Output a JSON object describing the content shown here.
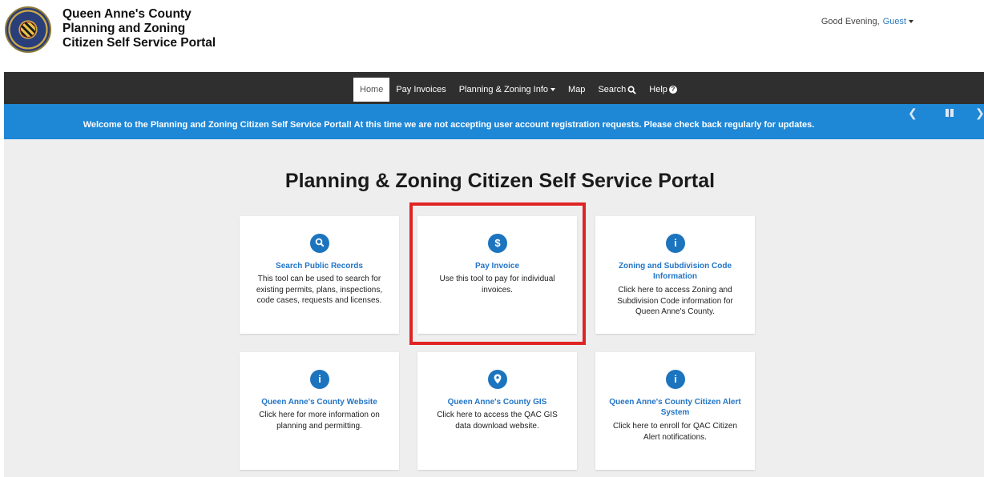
{
  "header": {
    "brand_line1": "Queen Anne's County",
    "brand_line2": "Planning and Zoning",
    "brand_line3": "Citizen Self Service Portal",
    "greeting": "Good Evening,",
    "user": "Guest"
  },
  "nav": {
    "items": [
      {
        "label": "Home",
        "active": true
      },
      {
        "label": "Pay Invoices"
      },
      {
        "label": "Planning & Zoning Info"
      },
      {
        "label": "Map"
      },
      {
        "label": "Search"
      },
      {
        "label": "Help"
      }
    ]
  },
  "banner": {
    "text": "Welcome to the Planning and Zoning Citizen Self Service Portal! At this time we are not accepting user account registration requests. Please check back regularly for updates."
  },
  "page": {
    "title": "Planning & Zoning Citizen Self Service Portal"
  },
  "cards": [
    {
      "icon": "search-icon",
      "title": "Search Public Records",
      "desc": "This tool can be used to search for existing permits, plans, inspections, code cases, requests and licenses."
    },
    {
      "icon": "dollar-icon",
      "title": "Pay Invoice",
      "desc": "Use this tool to pay for individual invoices."
    },
    {
      "icon": "info-icon",
      "title": "Zoning and Subdivision Code Information",
      "desc": "Click here to access Zoning and Subdivision Code information for Queen Anne's County."
    },
    {
      "icon": "info-icon",
      "title": "Queen Anne's County Website",
      "desc": "Click here for more information on planning and permitting."
    },
    {
      "icon": "location-icon",
      "title": "Queen Anne's County GIS",
      "desc": "Click here to access the QAC GIS data download website."
    },
    {
      "icon": "info-icon",
      "title": "Queen Anne's County Citizen Alert System",
      "desc": "Click here to enroll for QAC Citizen Alert notifications."
    }
  ],
  "colors": {
    "nav_bg": "#2f2f2f",
    "banner_bg": "#1e87d6",
    "accent": "#1c74bf",
    "highlight": "#e02424"
  }
}
